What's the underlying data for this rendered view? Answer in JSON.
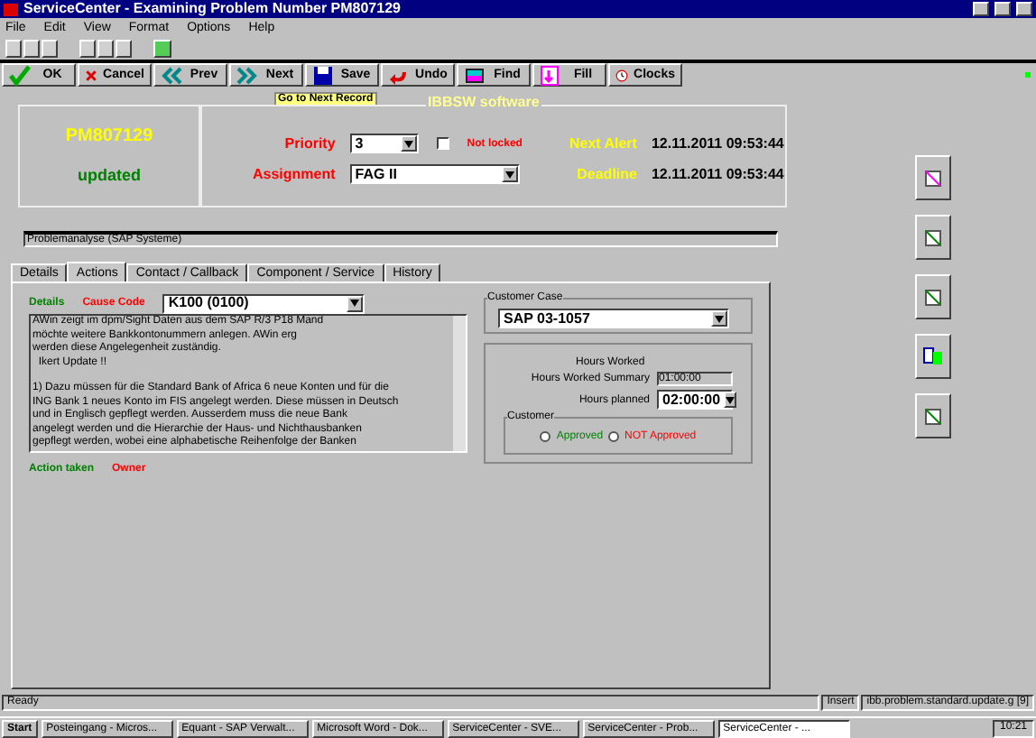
{
  "window": {
    "title": "ServiceCenter - Examining Problem Number PM807129"
  },
  "menu": [
    "File",
    "Edit",
    "View",
    "Format",
    "Options",
    "Help"
  ],
  "buttons": [
    {
      "label": "OK",
      "kind": "ok"
    },
    {
      "label": "Cancel",
      "kind": "cancel"
    },
    {
      "label": "Prev",
      "kind": "prev"
    },
    {
      "label": "Next",
      "kind": "next"
    },
    {
      "label": "Save",
      "kind": "save"
    },
    {
      "label": "Undo",
      "kind": "undo"
    },
    {
      "label": "Find",
      "kind": "find"
    },
    {
      "label": "Fill",
      "kind": "fill"
    },
    {
      "label": "Clocks",
      "kind": "clocks"
    }
  ],
  "header": {
    "tooltip": "Go to Next Record",
    "group_title": "IBBSW software",
    "number": "PM807129",
    "status": "updated",
    "priority_label": "Priority",
    "priority": "3",
    "not_locked": {
      "label": "Not locked",
      "checked": false
    },
    "assignment_label": "Assignment",
    "assignment": "FAG II",
    "next_alert_label": "Next Alert",
    "next_alert": "12.11.2011 09:53:44",
    "deadline_label": "Deadline",
    "deadline": "12.11.2011 09:53:44"
  },
  "brief_description": "Problemanalyse (SAP Systeme)",
  "tabs": [
    {
      "label": "Details",
      "selected": false
    },
    {
      "label": "Actions",
      "selected": true
    },
    {
      "label": "Contact / Callback",
      "selected": false
    },
    {
      "label": "Component / Service",
      "selected": false
    },
    {
      "label": "History",
      "selected": false
    }
  ],
  "actions": {
    "details_label": "Details",
    "cause_code_label": "Cause Code",
    "cause_code": "K100 (0100)",
    "description": [
      [
        "AWin zeigt im dpm/Sight Daten aus dem SAP R/3 P18 Mand",
        "möchte weitere Bankkontonummern anlegen. AWin erg",
        "werden diese Angelegenheit zuständig.",
        "  Ikert Update !!"
      ],
      [
        "1) Dazu müssen für die Standard Bank of Africa 6 neue Konten und für die",
        "ING Bank 1 neues Konto im FIS angelegt werden. Diese müssen in Deutsch",
        "und in Englisch gepflegt werden. Ausserdem muss die neue Bank",
        "angelegt werden und die Hierarchie der Haus- und Nichthausbanken",
        "gepflegt werden, wobei eine alphabetische Reihenfolge der Banken"
      ]
    ],
    "action_taken_label": "Action taken",
    "owner_label": "Owner",
    "customer_case_label": "Customer Case",
    "customer_case": "SAP 03-1057",
    "hours_worked_label": "Hours Worked",
    "summary_label": "Hours Worked Summary",
    "summary": "01:00:00",
    "planned_label": "Hours planned",
    "planned": "02:00:00",
    "customer_label": "Customer",
    "approval": [
      {
        "label": "Approved",
        "selected": false,
        "color": "#008000"
      },
      {
        "label": "NOT Approved",
        "selected": false,
        "color": "#ff0000"
      }
    ]
  },
  "status_bar": {
    "message": "Ready",
    "mode": "Insert",
    "form": "ibb.problem.standard.update.g [9]"
  },
  "taskbar": {
    "start": "Start",
    "items": [
      {
        "label": "Posteingang - Micros...",
        "selected": false
      },
      {
        "label": "Equant - SAP Verwalt...",
        "selected": false
      },
      {
        "label": "Microsoft Word - Dok...",
        "selected": false
      },
      {
        "label": "ServiceCenter - SVE...",
        "selected": false
      },
      {
        "label": "ServiceCenter - Prob...",
        "selected": false
      },
      {
        "label": "ServiceCenter - ...",
        "selected": true
      }
    ],
    "clock": "10:21"
  }
}
